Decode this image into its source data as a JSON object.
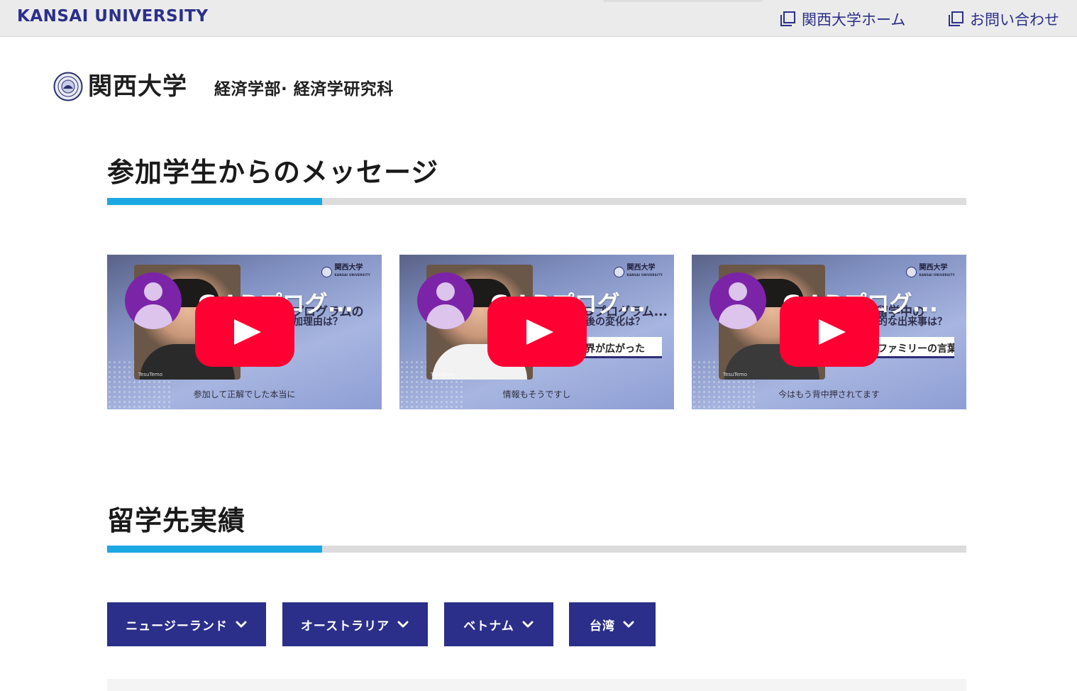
{
  "topbar": {
    "brand": "KANSAI UNIVERSITY",
    "links": [
      {
        "label": "関西大学ホーム",
        "icon": "external-window-icon"
      },
      {
        "label": "お問い合わせ",
        "icon": "external-window-icon"
      }
    ]
  },
  "header": {
    "logo_text": "関西大学",
    "faculty": "経済学部· 経済学研究科"
  },
  "sections": [
    {
      "title": "参加学生からのメッセージ"
    },
    {
      "title": "留学先実績"
    }
  ],
  "videos": [
    {
      "title": "G-LDプログ...",
      "channel": "関西大学",
      "channel_sub": "KANSAI UNIVERSITY",
      "overlay_line1": "プログラムの",
      "overlay_line2": "加理由は？",
      "tag": "",
      "watermark": "TesuTemo",
      "caption": "参加して正解でした本当に"
    },
    {
      "title": "G-LDプログ...",
      "channel": "関西大学",
      "channel_sub": "KANSAI UNIVERSITY",
      "overlay_line1": "Dプログラム...",
      "overlay_line2": "後の変化は？",
      "tag": "界が広がった",
      "watermark": "TesuTemo",
      "caption": "情報もそうですし"
    },
    {
      "title": "G-LDプログ...",
      "channel": "関西大学",
      "channel_sub": "KANSAI UNIVERSITY",
      "overlay_line1": "留学中の",
      "overlay_line2": "的な出来事は？",
      "tag": "ファミリーの言葉",
      "watermark": "TesuTemo",
      "caption": "今はもう背中押されてます"
    }
  ],
  "filters": [
    {
      "label": "ニュージーランド"
    },
    {
      "label": "オーストラリア"
    },
    {
      "label": "ベトナム"
    },
    {
      "label": "台湾"
    }
  ],
  "colors": {
    "brand_navy": "#2b2f8a",
    "accent_blue": "#1ba8e3",
    "youtube_red": "#ff0033",
    "avatar_purple": "#7c24a8"
  }
}
